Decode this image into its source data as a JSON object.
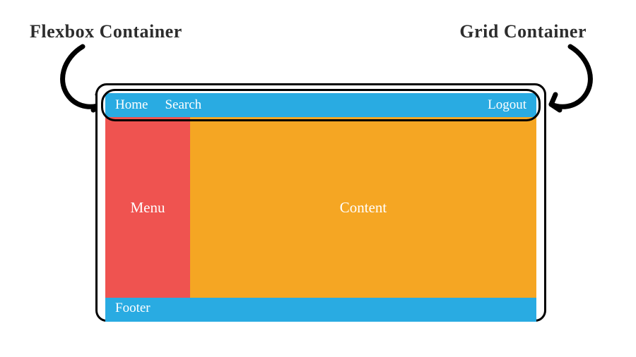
{
  "annotations": {
    "flexbox_label": "Flexbox Container",
    "grid_label": "Grid Container"
  },
  "header": {
    "home": "Home",
    "search": "Search",
    "logout": "Logout"
  },
  "menu": {
    "label": "Menu"
  },
  "content": {
    "label": "Content"
  },
  "footer": {
    "label": "Footer"
  },
  "colors": {
    "header": "#29abe2",
    "menu": "#ef5350",
    "content": "#f5a623",
    "footer": "#29abe2",
    "outline": "#000000",
    "text": "#ffffff"
  }
}
